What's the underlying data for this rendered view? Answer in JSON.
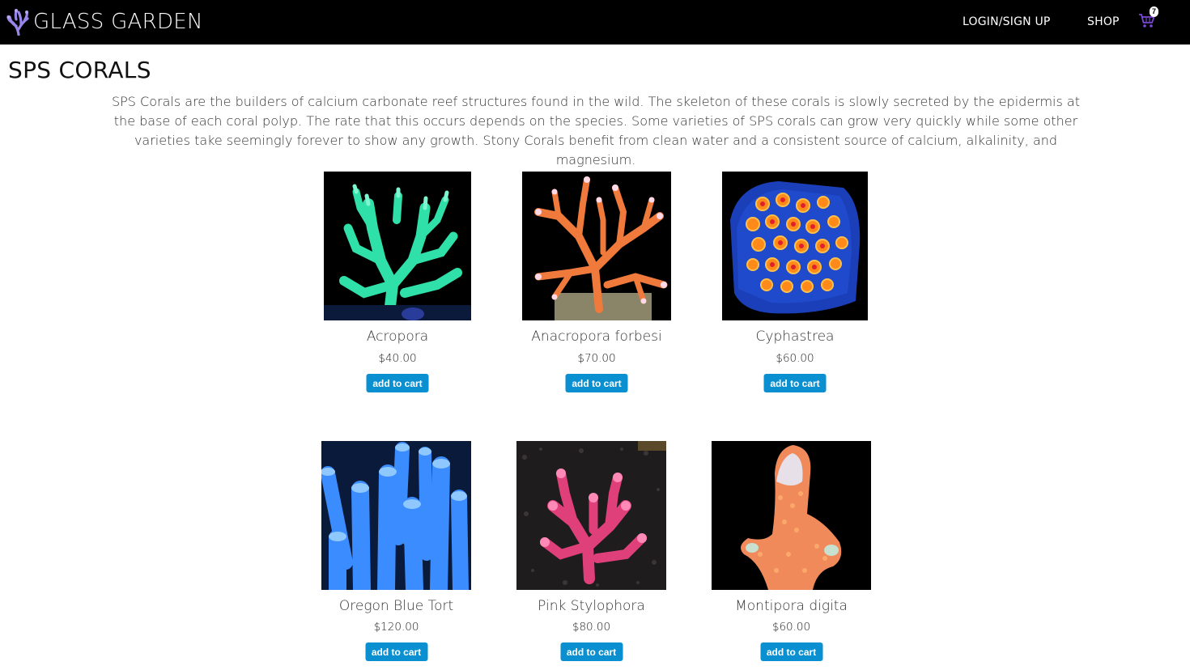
{
  "nav": {
    "brand": "GLASS GARDEN",
    "logo_icon": "coral-logo-icon",
    "links": [
      "LOGIN/SIGN UP",
      "SHOP"
    ],
    "cart_icon": "shopping-cart-icon",
    "cart_count": "7",
    "cart_color": "#7b4ad6"
  },
  "page": {
    "title": "SPS CORALS",
    "intro": "SPS Corals are the builders of calcium carbonate reef structures found in the wild. The skeleton of these corals is slowly secreted by the epidermis at the base of each coral polyp. The rate that this occurs depends on the species. Some varieties of SPS corals can grow very quickly while some other varieties take seemingly forever to show any growth. Stony Corals benefit from clean water and a consistent source of calcium, alkalinity, and magnesium."
  },
  "products": [
    {
      "name": "Acropora",
      "price": "$40.00",
      "button": "add to cart",
      "coral_color": "#2fe0a8"
    },
    {
      "name": "Anacropora forbesi",
      "price": "$70.00",
      "button": "add to cart",
      "coral_color": "#f07a3c"
    },
    {
      "name": "Cyphastrea",
      "price": "$60.00",
      "button": "add to cart",
      "coral_color": "#1a3fb8"
    },
    {
      "name": "Oregon Blue Tort",
      "price": "$120.00",
      "button": "add to cart",
      "coral_color": "#3a8cff"
    },
    {
      "name": "Pink Stylophora",
      "price": "$80.00",
      "button": "add to cart",
      "coral_color": "#e0407a"
    },
    {
      "name": "Montipora digita",
      "price": "$60.00",
      "button": "add to cart",
      "coral_color": "#f08a5a"
    }
  ],
  "colors": {
    "navbar": "#000000",
    "button": "#0a8fd0"
  }
}
